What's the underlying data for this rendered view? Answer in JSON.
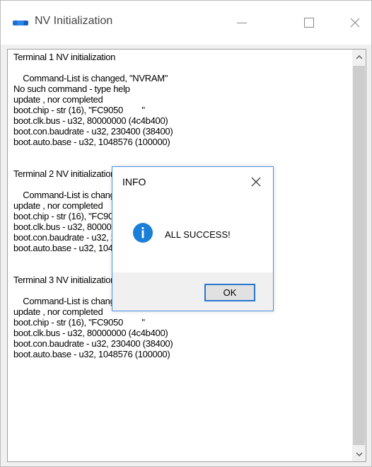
{
  "window": {
    "title": "NV Initialization",
    "app_icon": "app-logo-icon",
    "minimize_icon": "minimize-icon",
    "maximize_icon": "maximize-icon",
    "close_icon": "close-icon"
  },
  "log": {
    "lines": [
      "Terminal 1 NV initialization",
      "",
      "    Command-List is changed, \"NVRAM\"",
      "No such command - type help",
      "update , nor completed",
      "boot.chip - str (16), \"FC9050        \"",
      "boot.clk.bus - u32, 80000000 (4c4b400)",
      "boot.con.baudrate - u32, 230400 (38400)",
      "boot.auto.base - u32, 1048576 (100000)",
      "",
      "",
      "Terminal 2 NV initialization",
      "",
      "    Command-List is changed, \"NVRAM\"",
      "update , nor completed",
      "boot.chip - str (16), \"FC9050        \"",
      "boot.clk.bus - u32, 80000000 (4c4b400)",
      "boot.con.baudrate - u32, 230400 (38400)",
      "boot.auto.base - u32, 1048576 (100000)",
      "",
      "",
      "Terminal 3 NV initialization",
      "",
      "    Command-List is changed, \"NVRAM\"",
      "update , nor completed",
      "boot.chip - str (16), \"FC9050        \"",
      "boot.clk.bus - u32, 80000000 (4c4b400)",
      "boot.con.baudrate - u32, 230400 (38400)",
      "boot.auto.base - u32, 1048576 (100000)"
    ]
  },
  "dialog": {
    "title": "INFO",
    "message": "ALL SUCCESS!",
    "ok_label": "OK",
    "icon": "info-icon",
    "accent_color": "#1a7fd6"
  }
}
